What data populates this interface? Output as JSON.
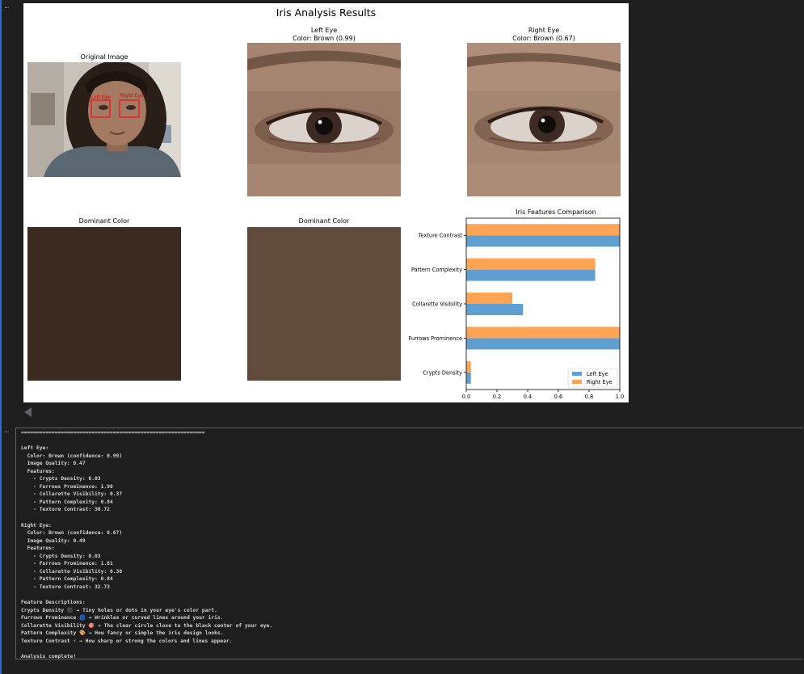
{
  "figure": {
    "suptitle": "Iris Analysis Results",
    "original_title": "Original Image",
    "left_eye_title_1": "Left Eye",
    "left_eye_title_2": "Color: Brown (0.99)",
    "right_eye_title_1": "Right Eye",
    "right_eye_title_2": "Color: Brown (0.67)",
    "dominant_left_title": "Dominant Color",
    "dominant_right_title": "Dominant Color",
    "dominant_left_color": "#3a2a20",
    "dominant_right_color": "#624b3c",
    "face_labels": [
      "Left Eye",
      "Right Eye"
    ]
  },
  "chart_data": {
    "type": "bar",
    "orientation": "horizontal",
    "title": "Iris Features Comparison",
    "categories": [
      "Crypts Density",
      "Furrows Prominence",
      "Collarette Visibility",
      "Pattern Complexity",
      "Texture Contrast"
    ],
    "series": [
      {
        "name": "Left Eye",
        "values": [
          0.03,
          1.0,
          0.37,
          0.84,
          1.0
        ],
        "color": "#5f9fd0"
      },
      {
        "name": "Right Eye",
        "values": [
          0.03,
          1.0,
          0.3,
          0.84,
          1.0
        ],
        "color": "#ffa455"
      }
    ],
    "xlim": [
      0,
      1.0
    ],
    "xticks": [
      "0.0",
      "0.2",
      "0.4",
      "0.6",
      "0.8",
      "1.0"
    ],
    "legend_position": "bottom-right",
    "grid": false
  },
  "cell": {
    "menu_top": "...",
    "menu_output": "..."
  },
  "output_text": "============================================================\n\nLeft Eye:\n  Color: Brown (confidence: 0.99)\n  Image Quality: 0.47\n  Features:\n    - Crypts Density: 0.03\n    - Furrows Prominence: 1.90\n    - Collarette Visibility: 0.37\n    - Pattern Complexity: 0.84\n    - Texture Contrast: 30.72\n\nRight Eye:\n  Color: Brown (confidence: 0.67)\n  Image Quality: 0.49\n  Features:\n    - Crypts Density: 0.03\n    - Furrows Prominence: 1.81\n    - Collarette Visibility: 0.30\n    - Pattern Complexity: 0.84\n    - Texture Contrast: 32.73\n\nFeature Descriptions:\nCrypts Density ⚫ → Tiny holes or dots in your eye's color part.\nFurrows Prominence 🌀 → Wrinkles or curved lines around your iris.\nCollarette Visibility 🎯 → The clear circle close to the black center of your eye.\nPattern Complexity 🎨 → How fancy or simple the iris design looks.\nTexture Contrast ⚡ → How sharp or strong the colors and lines appear.\n\nAnalysis complete!"
}
